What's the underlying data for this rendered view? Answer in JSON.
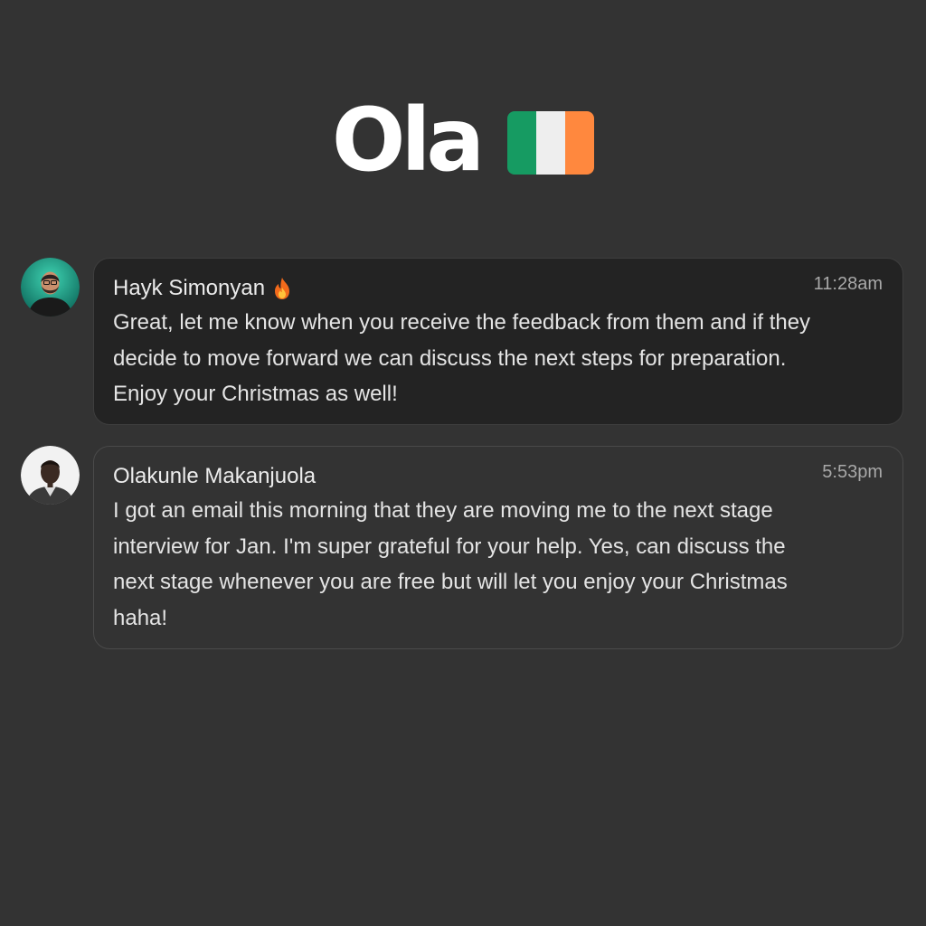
{
  "header": {
    "title": "Ola",
    "flag_colors": [
      "#169B62",
      "#EEEEEE",
      "#FF883E"
    ]
  },
  "messages": [
    {
      "sender": "Hayk Simonyan",
      "sender_icon": "fire-icon",
      "time": "11:28am",
      "lines": [
        "Great, let me know when you receive the feedback from them and if they",
        "decide to move forward we can discuss the next steps for preparation.",
        "Enjoy your Christmas as well!"
      ]
    },
    {
      "sender": "Olakunle Makanjuola",
      "time": "5:53pm",
      "lines": [
        "I got an email this morning that they are moving me to the next stage",
        "interview for Jan. I'm super grateful for your help. Yes, can discuss the",
        "next stage whenever you are free but will let you enjoy your Christmas",
        "haha!"
      ]
    }
  ],
  "colors": {
    "background": "#333333",
    "bubble_dark": "#232323",
    "text": "#E4E4E4",
    "time": "#A8A8A8"
  }
}
